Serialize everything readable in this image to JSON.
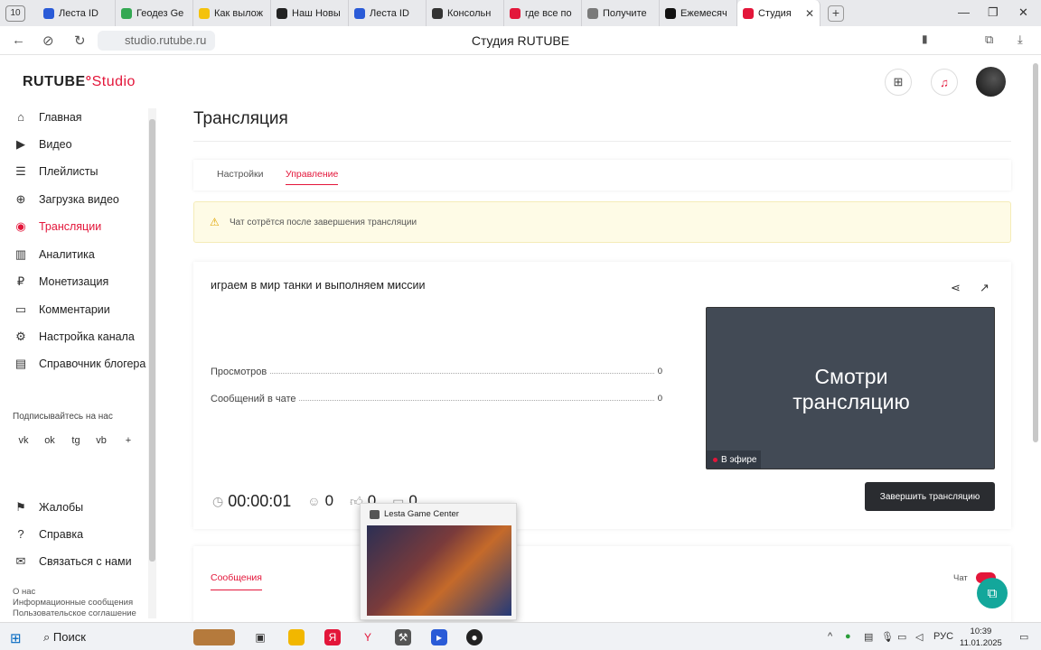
{
  "browser": {
    "tab_count": "10",
    "tabs": [
      {
        "label": "Леста ID",
        "color": "#2a5bd7"
      },
      {
        "label": "Геодез Ge",
        "color": "#34a853"
      },
      {
        "label": "Как вылож",
        "color": "#f4c20d"
      },
      {
        "label": "Наш Новы",
        "color": "#222222"
      },
      {
        "label": "Леста ID",
        "color": "#2a5bd7"
      },
      {
        "label": "Консольн",
        "color": "#333333"
      },
      {
        "label": "где все по",
        "color": "#e3163a"
      },
      {
        "label": "Получите",
        "color": "#7a7a7a"
      },
      {
        "label": "Ежемесяч",
        "color": "#111111"
      },
      {
        "label": "Студия",
        "color": "#e3163a"
      }
    ],
    "new_tab": "+",
    "url": "studio.rutube.ru",
    "page_title": "Студия RUTUBE"
  },
  "header": {
    "logo_main": "RUTUBE",
    "logo_studio": "Studio"
  },
  "sidebar": {
    "items": [
      {
        "label": "Главная",
        "icon": "⌂"
      },
      {
        "label": "Видео",
        "icon": "▶"
      },
      {
        "label": "Плейлисты",
        "icon": "☰"
      },
      {
        "label": "Загрузка видео",
        "icon": "⊕"
      },
      {
        "label": "Трансляции",
        "icon": "◉"
      },
      {
        "label": "Аналитика",
        "icon": "▥"
      },
      {
        "label": "Монетизация",
        "icon": "₽"
      },
      {
        "label": "Комментарии",
        "icon": "▭"
      },
      {
        "label": "Настройка канала",
        "icon": "⚙"
      },
      {
        "label": "Справочник блогера",
        "icon": "▤"
      }
    ],
    "follow_label": "Подписывайтесь на нас",
    "socials": [
      "vk",
      "ok",
      "tg",
      "vb",
      "+"
    ],
    "bottom_items": [
      {
        "label": "Жалобы",
        "icon": "⚑"
      },
      {
        "label": "Справка",
        "icon": "?"
      },
      {
        "label": "Связаться с нами",
        "icon": "✉"
      }
    ],
    "footer_links": [
      "О нас",
      "Информационные сообщения",
      "Пользовательское соглашение"
    ]
  },
  "main": {
    "title": "Трансляция",
    "tabs": [
      "Настройки",
      "Управление"
    ],
    "notice": "Чат сотрётся после завершения трансляции",
    "stream": {
      "title": "играем в мир танки и выполняем миссии",
      "stats": [
        {
          "label": "Просмотров",
          "value": "0"
        },
        {
          "label": "Сообщений в чате",
          "value": "0"
        }
      ],
      "preview_text_1": "Смотри",
      "preview_text_2": "трансляцию",
      "live_badge": "В эфире",
      "timer": "00:00:01",
      "viewers": "0",
      "likes": "0",
      "messages": "0",
      "end_button": "Завершить трансляцию"
    },
    "messages_tab": "Сообщения",
    "chat_label": "Чат"
  },
  "popup": {
    "title": "Lesta Game Center"
  },
  "taskbar": {
    "search": "Поиск",
    "lang": "РУС",
    "time": "10:39",
    "date": "11.01.2025"
  }
}
